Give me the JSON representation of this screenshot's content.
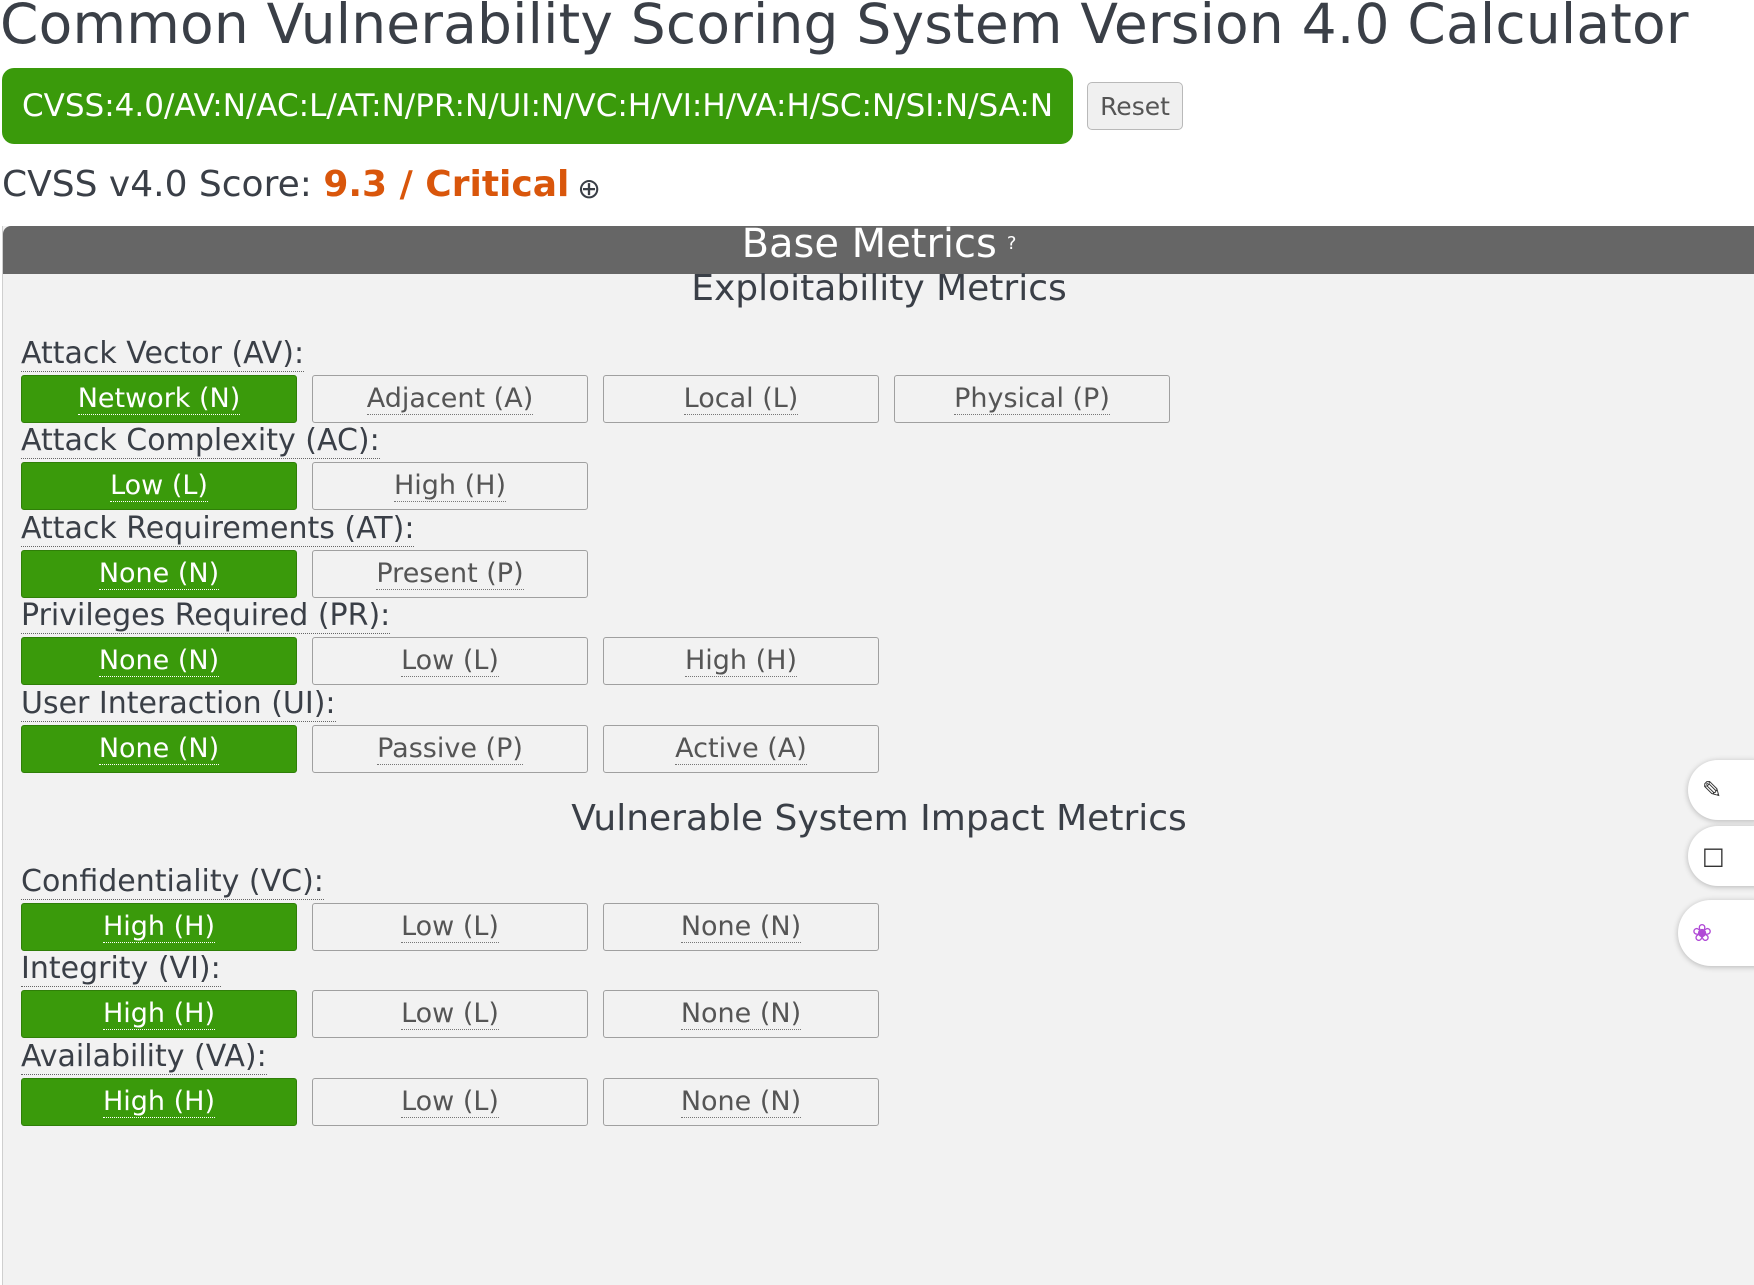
{
  "page": {
    "title": "Common Vulnerability Scoring System Version 4.0 Calculator"
  },
  "vector": {
    "string": "CVSS:4.0/AV:N/AC:L/AT:N/PR:N/UI:N/VC:H/VI:H/VA:H/SC:N/SI:N/SA:N",
    "reset_label": "Reset"
  },
  "score": {
    "prefix": "CVSS v4.0 Score: ",
    "value": "9.3 / Critical",
    "expand_glyph": "⊕"
  },
  "base": {
    "header": "Base Metrics",
    "help_glyph": "?",
    "exploitability_title": "Exploitability Metrics",
    "impact_title": "Vulnerable System Impact Metrics",
    "metrics": [
      {
        "label": "Attack Vector (AV):",
        "options": [
          "Network (N)",
          "Adjacent (A)",
          "Local (L)",
          "Physical (P)"
        ],
        "selected": 0
      },
      {
        "label": "Attack Complexity (AC):",
        "options": [
          "Low (L)",
          "High (H)"
        ],
        "selected": 0
      },
      {
        "label": "Attack Requirements (AT):",
        "options": [
          "None (N)",
          "Present (P)"
        ],
        "selected": 0
      },
      {
        "label": "Privileges Required (PR):",
        "options": [
          "None (N)",
          "Low (L)",
          "High (H)"
        ],
        "selected": 0
      },
      {
        "label": "User Interaction (UI):",
        "options": [
          "None (N)",
          "Passive (P)",
          "Active (A)"
        ],
        "selected": 0
      },
      {
        "label": "Confidentiality (VC):",
        "options": [
          "High (H)",
          "Low (L)",
          "None (N)"
        ],
        "selected": 0
      },
      {
        "label": "Integrity (VI):",
        "options": [
          "High (H)",
          "Low (L)",
          "None (N)"
        ],
        "selected": 0
      },
      {
        "label": "Availability (VA):",
        "options": [
          "High (H)",
          "Low (L)",
          "None (N)"
        ],
        "selected": 0
      }
    ]
  },
  "side_tools": {
    "icons": [
      "edit-icon",
      "document-icon",
      "assistant-icon"
    ]
  },
  "colors": {
    "selected_green": "#3a9a0b",
    "score_orange": "#d9560b",
    "header_gray": "#666666"
  }
}
